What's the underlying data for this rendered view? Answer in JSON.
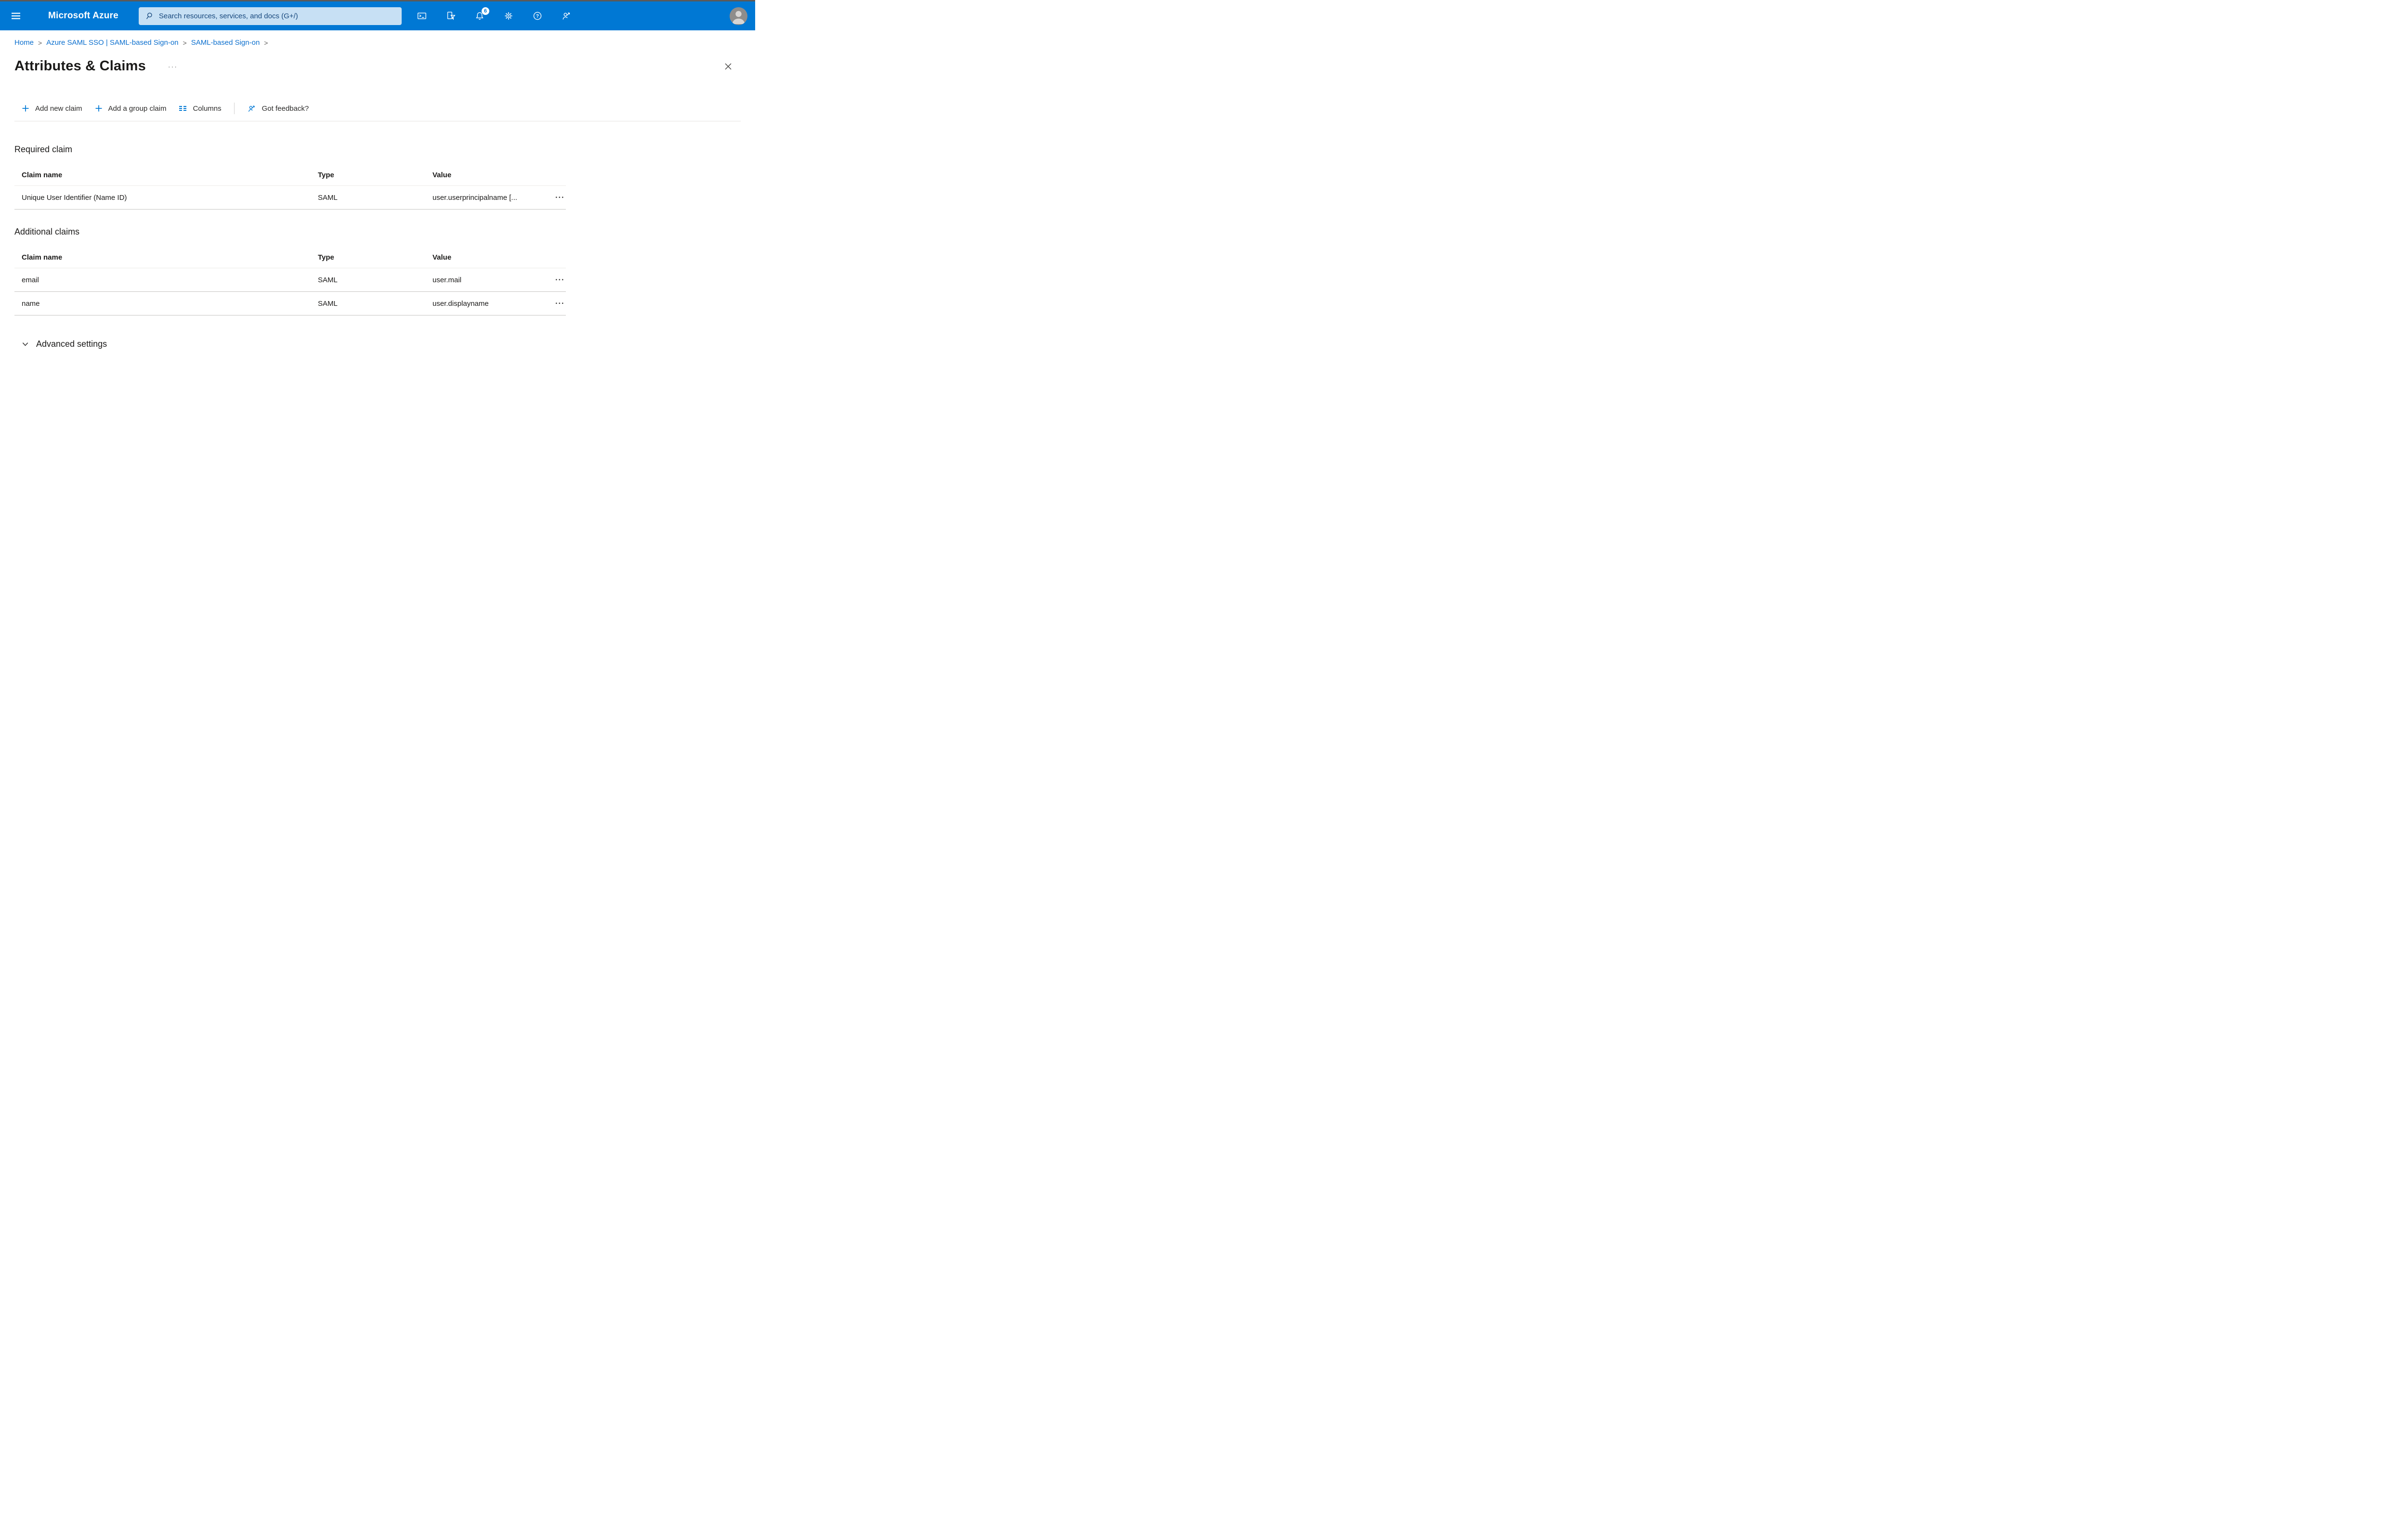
{
  "topbar": {
    "brand": "Microsoft Azure",
    "search": {
      "placeholder": "Search resources, services, and docs (G+/)",
      "value": ""
    },
    "notification_count": "6"
  },
  "breadcrumb": {
    "separator": ">",
    "items": [
      "Home",
      "Azure SAML SSO | SAML-based Sign-on",
      "SAML-based Sign-on"
    ]
  },
  "page": {
    "title": "Attributes & Claims"
  },
  "icons": {
    "title_more": "···",
    "row_menu": "•••"
  },
  "toolbar": {
    "items": [
      {
        "label": "Add new claim"
      },
      {
        "label": "Add a group claim"
      },
      {
        "label": "Columns"
      },
      {
        "label": "Got feedback?"
      }
    ]
  },
  "sections": {
    "required": {
      "heading": "Required claim",
      "columns": [
        "Claim name",
        "Type",
        "Value"
      ],
      "rows": [
        {
          "name": "Unique User Identifier (Name ID)",
          "type": "SAML",
          "value": "user.userprincipalname [..."
        }
      ]
    },
    "additional": {
      "heading": "Additional claims",
      "columns": [
        "Claim name",
        "Type",
        "Value"
      ],
      "rows": [
        {
          "name": "email",
          "type": "SAML",
          "value": "user.mail"
        },
        {
          "name": "name",
          "type": "SAML",
          "value": "user.displayname"
        }
      ]
    }
  },
  "advanced": {
    "label": "Advanced settings"
  },
  "colors": {
    "topbar_blue": "#0078d4",
    "search_bg": "#c7e0f4",
    "link_blue": "#0b6fce",
    "text": "#1b1a19",
    "row_border": "#c6c4c2"
  }
}
